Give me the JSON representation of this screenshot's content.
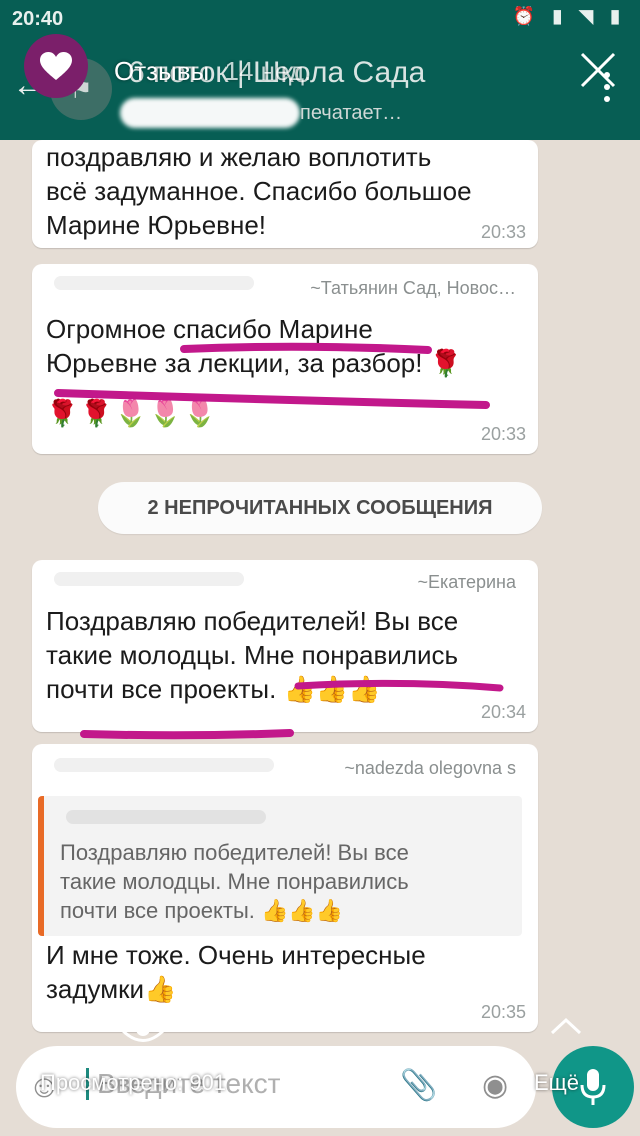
{
  "status_bar": {
    "time": "20:40"
  },
  "chat_header": {
    "title": "6 поток | Школа Сада",
    "subtitle": "печатает…",
    "back_icon": "arrow-left-icon",
    "menu_icon": "more-vertical-icon"
  },
  "story_overlay": {
    "label": "Отзывы",
    "age": "14 нед.",
    "views": "Просмотрено: 901",
    "more": "Ещё"
  },
  "messages": [
    {
      "lines": [
        "поздравляю и желаю воплотить",
        "всё задуманное. Спасибо большое",
        "Марине Юрьевне!"
      ],
      "time": "20:33"
    },
    {
      "sender": "~Татьянин Сад, Новос…",
      "lines": [
        "Огромное спасибо Марине",
        "Юрьевне за лекции, за разбор! 🌹"
      ],
      "emojis": "🌹🌹🌷🌷🌷",
      "time": "20:33"
    },
    {
      "sender": "~Екатерина",
      "lines": [
        "Поздравляю победителей! Вы все",
        "такие молодцы. Мне понравились",
        "почти все проекты. 👍👍👍"
      ],
      "time": "20:34"
    },
    {
      "sender": "~nadezda olegovna s",
      "quote_lines": [
        "Поздравляю победителей! Вы все",
        "такие молодцы. Мне понравились",
        "почти все проекты. 👍👍👍"
      ],
      "lines": [
        "И мне тоже. Очень интересные",
        "задумки👍"
      ],
      "time": "20:35"
    }
  ],
  "unread_banner": "2 НЕПРОЧИТАННЫХ СООБЩЕНИЯ",
  "composer": {
    "placeholder": "Введите текст"
  },
  "colors": {
    "header": "#075e54",
    "chat_bg": "#e5ddd5",
    "highlight": "#c2188b",
    "mic": "#109688"
  }
}
